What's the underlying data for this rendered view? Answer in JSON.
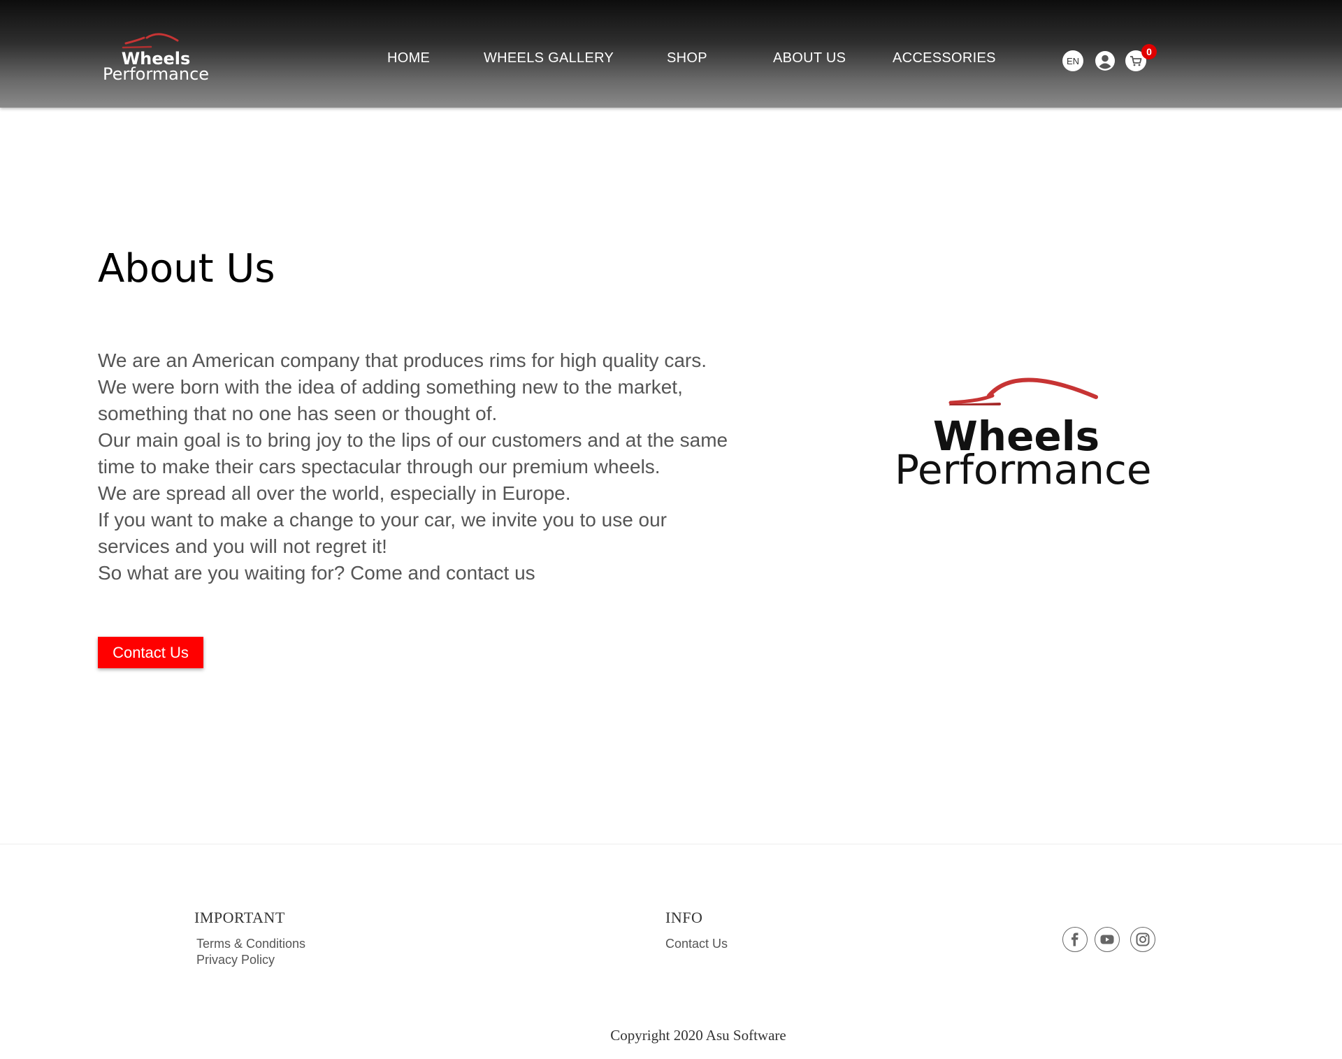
{
  "header": {
    "logo": {
      "line1": "Wheels",
      "line2": "Performance"
    },
    "nav": [
      {
        "label": "HOME"
      },
      {
        "label": "WHEELS GALLERY"
      },
      {
        "label": "SHOP"
      },
      {
        "label": "ABOUT US"
      },
      {
        "label": "ACCESSORIES"
      }
    ],
    "language": "EN",
    "cart_count": "0",
    "icons": [
      "user-icon",
      "cart-icon"
    ]
  },
  "main": {
    "title": "About Us",
    "paragraph_lines": [
      "We are an American company that produces rims for high quality cars.",
      "We were born with the idea of adding something new to the market,",
      "something that no one has seen or thought of.",
      "Our main goal is to bring joy to the lips of our customers and at the same",
      "time to make their cars spectacular through our premium wheels.",
      "We are spread all over the world, especially in Europe.",
      "If you want to make a change to your car, we invite you to use our",
      "services and you will not regret it!",
      "So what are you waiting for? Come and contact us"
    ],
    "contact_button": "Contact Us",
    "brand_logo": {
      "line1": "Wheels",
      "line2": "Performance"
    }
  },
  "footer": {
    "important": {
      "heading": "IMPORTANT",
      "links": [
        "Terms & Conditions",
        "Privacy Policy"
      ]
    },
    "info": {
      "heading": "INFO",
      "links": [
        "Contact Us"
      ]
    },
    "social": [
      "facebook-icon",
      "youtube-icon",
      "instagram-icon"
    ],
    "copyright": "Copyright 2020 Asu Software"
  },
  "colors": {
    "accent": "#ff0000",
    "logo_arc": "#c73434",
    "badge": "#e00000",
    "body_text": "#555555"
  }
}
